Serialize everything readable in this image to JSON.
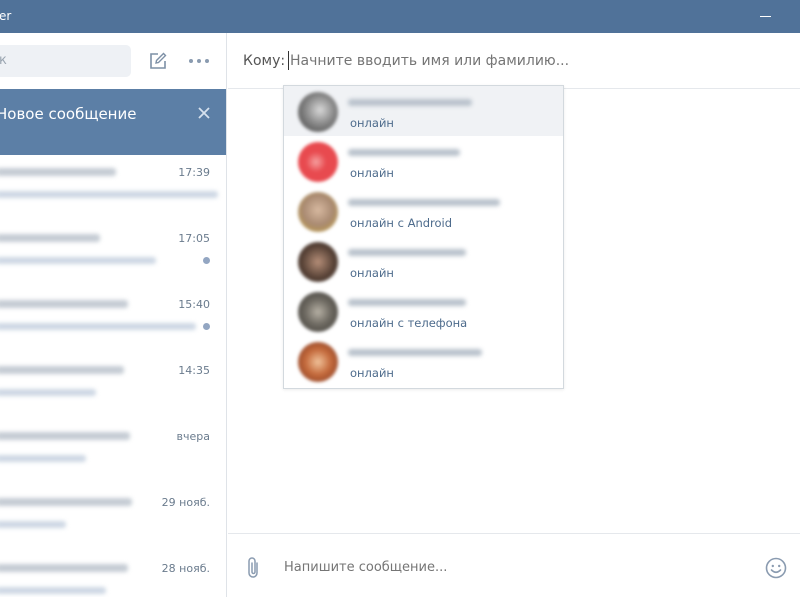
{
  "window": {
    "title_fragment": "er"
  },
  "sidebar": {
    "search_placeholder": "к",
    "new_message_label": "Новое сообщение",
    "conversations": [
      {
        "time": "17:39",
        "unread": false
      },
      {
        "time": "17:05",
        "unread": true
      },
      {
        "time": "15:40",
        "unread": true
      },
      {
        "time": "14:35",
        "unread": false
      },
      {
        "time": "вчера",
        "unread": false
      },
      {
        "time": "29 нояб.",
        "unread": false
      },
      {
        "time": "28 нояб.",
        "unread": false
      }
    ]
  },
  "composer": {
    "to_label": "Кому:",
    "to_placeholder": "Начните вводить имя или фамилию...",
    "message_placeholder": "Напишите сообщение..."
  },
  "suggestions": [
    {
      "status": "онлайн",
      "avatar_color": "#707070",
      "active": true
    },
    {
      "status": "онлайн",
      "avatar_color": "#e84a4f",
      "active": false
    },
    {
      "status": "онлайн с Android",
      "avatar_color": "#b08f78",
      "active": false
    },
    {
      "status": "онлайн",
      "avatar_color": "#5a4438",
      "active": false
    },
    {
      "status": "онлайн с телефона",
      "avatar_color": "#6e6a62",
      "active": false
    },
    {
      "status": "онлайн",
      "avatar_color": "#c46a3c",
      "active": false
    }
  ],
  "colors": {
    "titlebar": "#507299",
    "active_header": "#5c7fa6",
    "status_text": "#4d6b8c"
  }
}
